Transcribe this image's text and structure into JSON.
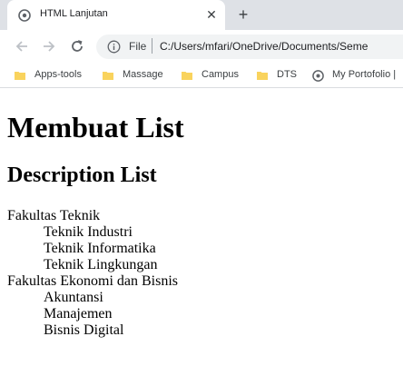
{
  "browser": {
    "tab": {
      "title": "HTML Lanjutan",
      "close_icon": "close-icon",
      "favicon": "globe-icon"
    },
    "new_tab_glyph": "+",
    "toolbar": {
      "scheme_label": "File",
      "url": "C:/Users/mfari/OneDrive/Documents/Seme"
    },
    "bookmarks": [
      {
        "label": "Apps-tools",
        "icon": "folder-icon"
      },
      {
        "label": "Massage",
        "icon": "folder-icon"
      },
      {
        "label": "Campus",
        "icon": "folder-icon"
      },
      {
        "label": "DTS",
        "icon": "folder-icon"
      },
      {
        "label": "My Portofolio |",
        "icon": "globe-icon"
      }
    ],
    "colors": {
      "tabstrip": "#dee1e6",
      "omnibox": "#f1f3f4",
      "folder": "#f9d35d"
    }
  },
  "page": {
    "h1": "Membuat List",
    "h2": "Description List",
    "list": [
      {
        "term": "Fakultas Teknik",
        "items": [
          "Teknik Industri",
          "Teknik Informatika",
          "Teknik Lingkungan"
        ]
      },
      {
        "term": "Fakultas Ekonomi dan Bisnis",
        "items": [
          "Akuntansi",
          "Manajemen",
          "Bisnis Digital"
        ]
      }
    ]
  }
}
